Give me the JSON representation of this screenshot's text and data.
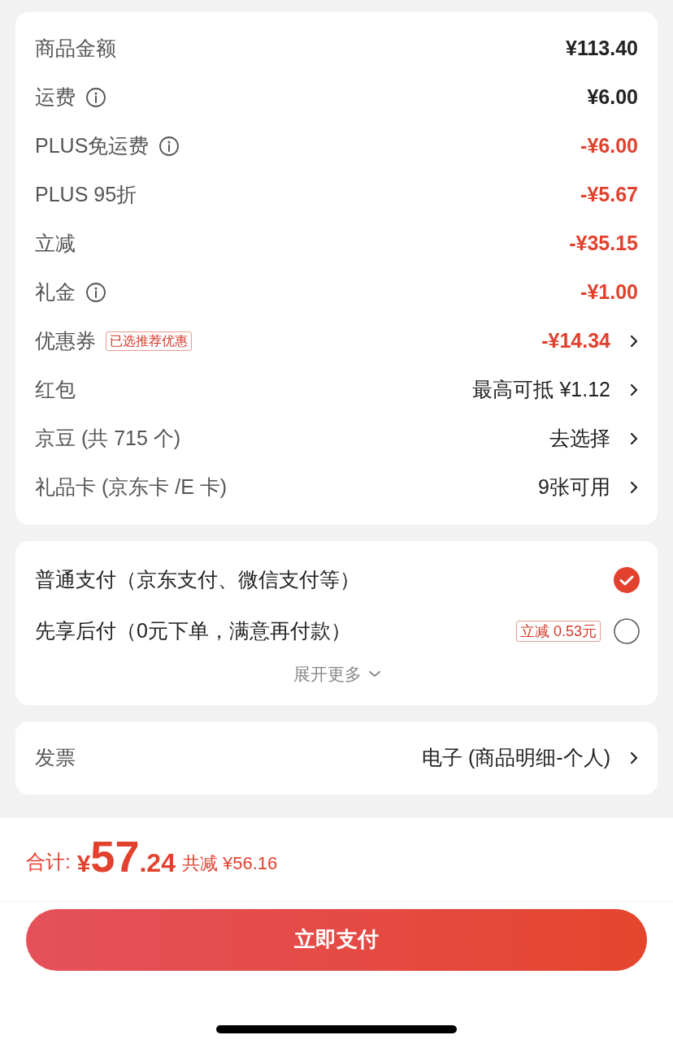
{
  "fees": [
    {
      "label": "商品金额",
      "info": false,
      "value": "¥113.40",
      "kind": "amount",
      "chevron": false
    },
    {
      "label": "运费",
      "info": true,
      "value": "¥6.00",
      "kind": "amount",
      "chevron": false
    },
    {
      "label": "PLUS免运费",
      "info": true,
      "value": "-¥6.00",
      "kind": "discount",
      "chevron": false
    },
    {
      "label": "PLUS 95折",
      "info": false,
      "value": "-¥5.67",
      "kind": "discount",
      "chevron": false
    },
    {
      "label": "立减",
      "info": false,
      "value": "-¥35.15",
      "kind": "discount",
      "chevron": false
    },
    {
      "label": "礼金",
      "info": true,
      "value": "-¥1.00",
      "kind": "discount",
      "chevron": false
    },
    {
      "label": "优惠券",
      "info": false,
      "tag": "已选推荐优惠",
      "value": "-¥14.34",
      "kind": "discount",
      "chevron": true
    },
    {
      "label": "红包",
      "info": false,
      "value": "最高可抵 ¥1.12",
      "kind": "option",
      "chevron": true
    },
    {
      "label": "京豆 (共 715 个)",
      "info": false,
      "value": "去选择",
      "kind": "option",
      "chevron": true
    },
    {
      "label": "礼品卡 (京东卡 /E 卡)",
      "info": false,
      "value": "9张可用",
      "kind": "option",
      "chevron": true
    }
  ],
  "payment_methods": [
    {
      "label": "普通支付（京东支付、微信支付等）",
      "selected": true
    },
    {
      "label": "先享后付（0元下单，满意再付款）",
      "tag": "立减 0.53元",
      "selected": false
    }
  ],
  "expand_more": "展开更多",
  "invoice": {
    "label": "发票",
    "value": "电子 (商品明细-个人)"
  },
  "total": {
    "label": "合计:",
    "currency": "¥",
    "integer": "57",
    "decimal": ".24",
    "savings": "共减 ¥56.16"
  },
  "pay_button": "立即支付"
}
